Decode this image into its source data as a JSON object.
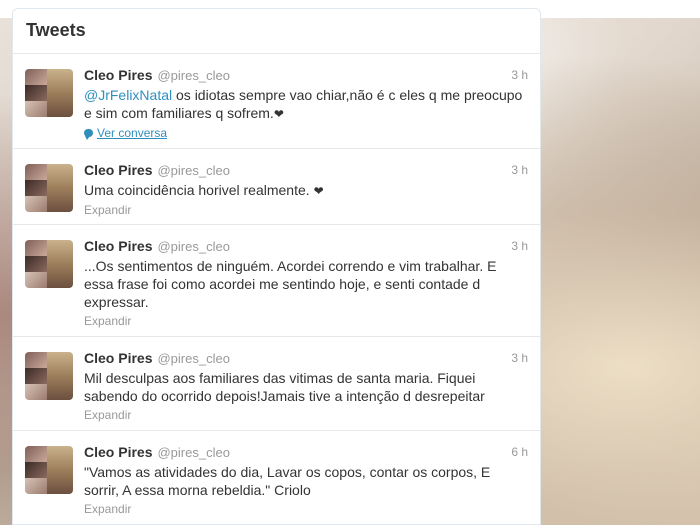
{
  "stream": {
    "title": "Tweets"
  },
  "tweets": [
    {
      "fullname": "Cleo Pires",
      "username": "@pires_cleo",
      "time": "3 h",
      "mention": "@JrFelixNatal",
      "text": " os idiotas sempre vao chiar,não é c eles q me preocupo e sim com familiares q sofrem.",
      "heart": "❤",
      "footer": "Ver conversa"
    },
    {
      "fullname": "Cleo Pires",
      "username": "@pires_cleo",
      "time": "3 h",
      "text": "Uma coincidência horivel realmente. ",
      "heart": "❤",
      "footer": "Expandir"
    },
    {
      "fullname": "Cleo Pires",
      "username": "@pires_cleo",
      "time": "3 h",
      "text": "...Os sentimentos de ninguém. Acordei correndo e vim trabalhar. E essa frase foi como acordei me sentindo hoje, e senti contade d expressar.",
      "footer": "Expandir"
    },
    {
      "fullname": "Cleo Pires",
      "username": "@pires_cleo",
      "time": "3 h",
      "text": "Mil desculpas aos familiares das vitimas de santa maria. Fiquei sabendo do ocorrido depois!Jamais tive a intenção d desrepeitar",
      "footer": "Expandir"
    },
    {
      "fullname": "Cleo Pires",
      "username": "@pires_cleo",
      "time": "6 h",
      "text": "\"Vamos as atividades do dia, Lavar os copos, contar os corpos, E sorrir, A essa morna rebeldia.\" Criolo",
      "footer": "Expandir"
    }
  ],
  "colors": {
    "link": "#2e8fbd",
    "text": "#333333",
    "muted": "#999999"
  },
  "icons": {
    "conversation": "speech-bubble-icon",
    "heart": "heart-icon"
  }
}
